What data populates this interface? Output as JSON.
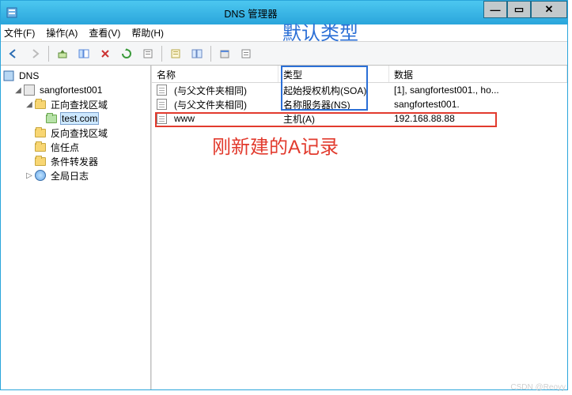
{
  "window": {
    "title": "DNS 管理器"
  },
  "menu": {
    "file": "文件(F)",
    "action": "操作(A)",
    "view": "查看(V)",
    "help": "帮助(H)"
  },
  "tree": {
    "root": "DNS",
    "server": "sangfortest001",
    "forward_zone": "正向查找区域",
    "zone": "test.com",
    "reverse_zone": "反向查找区域",
    "trust_points": "信任点",
    "conditional_forwarders": "条件转发器",
    "global_log": "全局日志"
  },
  "list": {
    "headers": {
      "name": "名称",
      "type": "类型",
      "data": "数据"
    },
    "rows": [
      {
        "name": "(与父文件夹相同)",
        "type": "起始授权机构(SOA)",
        "data": "[1], sangfortest001., ho..."
      },
      {
        "name": "(与父文件夹相同)",
        "type": "名称服务器(NS)",
        "data": "sangfortest001."
      },
      {
        "name": "www",
        "type": "主机(A)",
        "data": "192.168.88.88"
      }
    ]
  },
  "annotations": {
    "default_type": "默认类型",
    "new_a_record": "刚新建的A记录"
  },
  "watermark": "CSDN @Reoyy"
}
